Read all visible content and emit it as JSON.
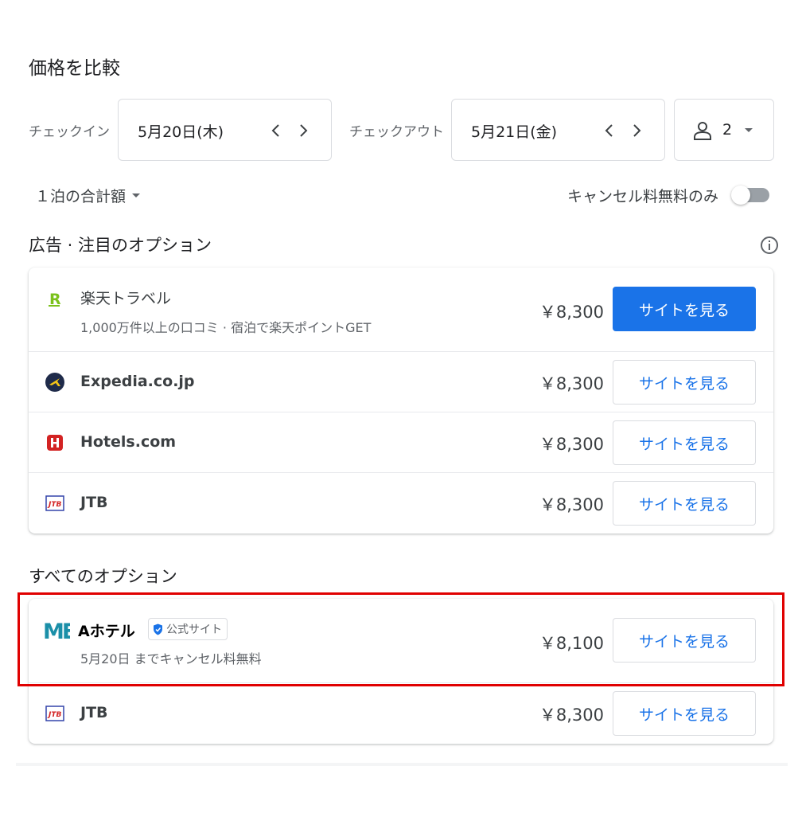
{
  "header": {
    "title": "価格を比較"
  },
  "search": {
    "checkin_label": "チェックイン",
    "checkin_date": "5月20日(木)",
    "checkout_label": "チェックアウト",
    "checkout_date": "5月21日(金)",
    "guests": "2"
  },
  "options": {
    "total_label": "１泊の合計額",
    "cancel_label": "キャンセル料無料のみ",
    "cancel_toggle_on": false
  },
  "featured": {
    "title": "広告 · 注目のオプション",
    "rows": [
      {
        "name": "楽天トラベル",
        "subtitle": "1,000万件以上の口コミ · 宿泊で楽天ポイントGET",
        "price": "￥8,300",
        "button": "サイトを見る",
        "logo": "rakuten-logo"
      },
      {
        "name": "Expedia.co.jp",
        "price": "￥8,300",
        "button": "サイトを見る",
        "logo": "expedia-logo"
      },
      {
        "name": "Hotels.com",
        "price": "￥8,300",
        "button": "サイトを見る",
        "logo": "hotels-logo"
      },
      {
        "name": "JTB",
        "price": "￥8,300",
        "button": "サイトを見る",
        "logo": "jtb-logo"
      }
    ]
  },
  "all": {
    "title": "すべてのオプション",
    "rows": [
      {
        "name": "Aホテル",
        "badge": "公式サイト",
        "subtitle": "5月20日 までキャンセル料無料",
        "price": "￥8,100",
        "button": "サイトを見る",
        "logo": "me-logo"
      },
      {
        "name": "JTB",
        "price": "￥8,300",
        "button": "サイトを見る",
        "logo": "jtb-logo"
      }
    ]
  },
  "colors": {
    "accent": "#1a73e8",
    "highlight": "#e00000",
    "rakuten": "#7bc11c",
    "hotels": "#d32323",
    "me_logo": "#1b8fa8"
  }
}
